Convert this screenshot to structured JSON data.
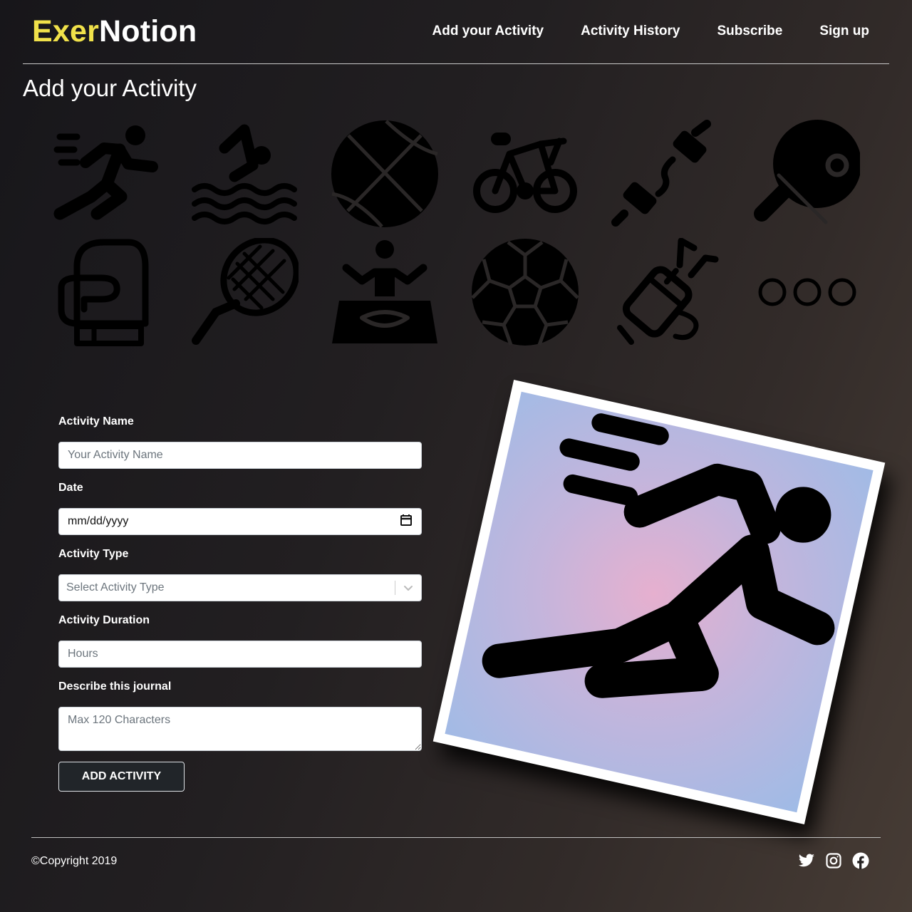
{
  "brand": {
    "part1": "Exer",
    "part2": "Notion"
  },
  "nav": [
    "Add your Activity",
    "Activity History",
    "Subscribe",
    "Sign up"
  ],
  "page_title": "Add your Activity",
  "activities": [
    {
      "icon": "running-icon"
    },
    {
      "icon": "swimming-icon"
    },
    {
      "icon": "basketball-icon"
    },
    {
      "icon": "bicycle-icon"
    },
    {
      "icon": "jump-rope-icon"
    },
    {
      "icon": "table-tennis-icon"
    },
    {
      "icon": "boxing-glove-icon"
    },
    {
      "icon": "tennis-racket-icon"
    },
    {
      "icon": "yoga-icon"
    },
    {
      "icon": "soccer-ball-icon"
    },
    {
      "icon": "golf-bag-icon"
    },
    {
      "icon": "more-icon"
    }
  ],
  "form": {
    "name_label": "Activity Name",
    "name_placeholder": "Your Activity Name",
    "date_label": "Date",
    "date_value": "mm/dd/yyyy",
    "type_label": "Activity Type",
    "type_placeholder": "Select Activity Type",
    "duration_label": "Activity Duration",
    "duration_placeholder": "Hours",
    "description_label": "Describe this journal",
    "description_placeholder": "Max 120 Characters",
    "submit_label": "ADD ACTIVITY"
  },
  "illustration": {
    "icon": "running-icon"
  },
  "footer": {
    "copyright": "©Copyright 2019",
    "social": [
      "twitter-icon",
      "instagram-icon",
      "facebook-icon"
    ]
  },
  "colors": {
    "brand_accent": "#f0e14a",
    "button_bg": "#212529"
  }
}
